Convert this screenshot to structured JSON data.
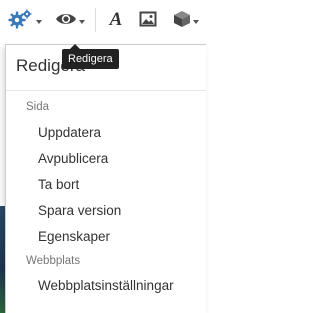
{
  "toolbar": {
    "settings_button": {
      "icon": "gear-icon",
      "color": "#3b78b7"
    },
    "view_button": {
      "icon": "eye-icon"
    },
    "text_button": {
      "icon": "text-icon",
      "glyph": "A"
    },
    "image_button": {
      "icon": "image-icon"
    },
    "block_button": {
      "icon": "cube-icon"
    }
  },
  "tooltip": {
    "text": "Redigera"
  },
  "menu": {
    "title": "Redigera",
    "sections": [
      {
        "label": "Sida",
        "items": [
          "Uppdatera",
          "Avpublicera",
          "Ta bort",
          "Spara version",
          "Egenskaper"
        ]
      },
      {
        "label": "Webbplats",
        "items": [
          "Webbplatsinställningar"
        ]
      }
    ]
  }
}
